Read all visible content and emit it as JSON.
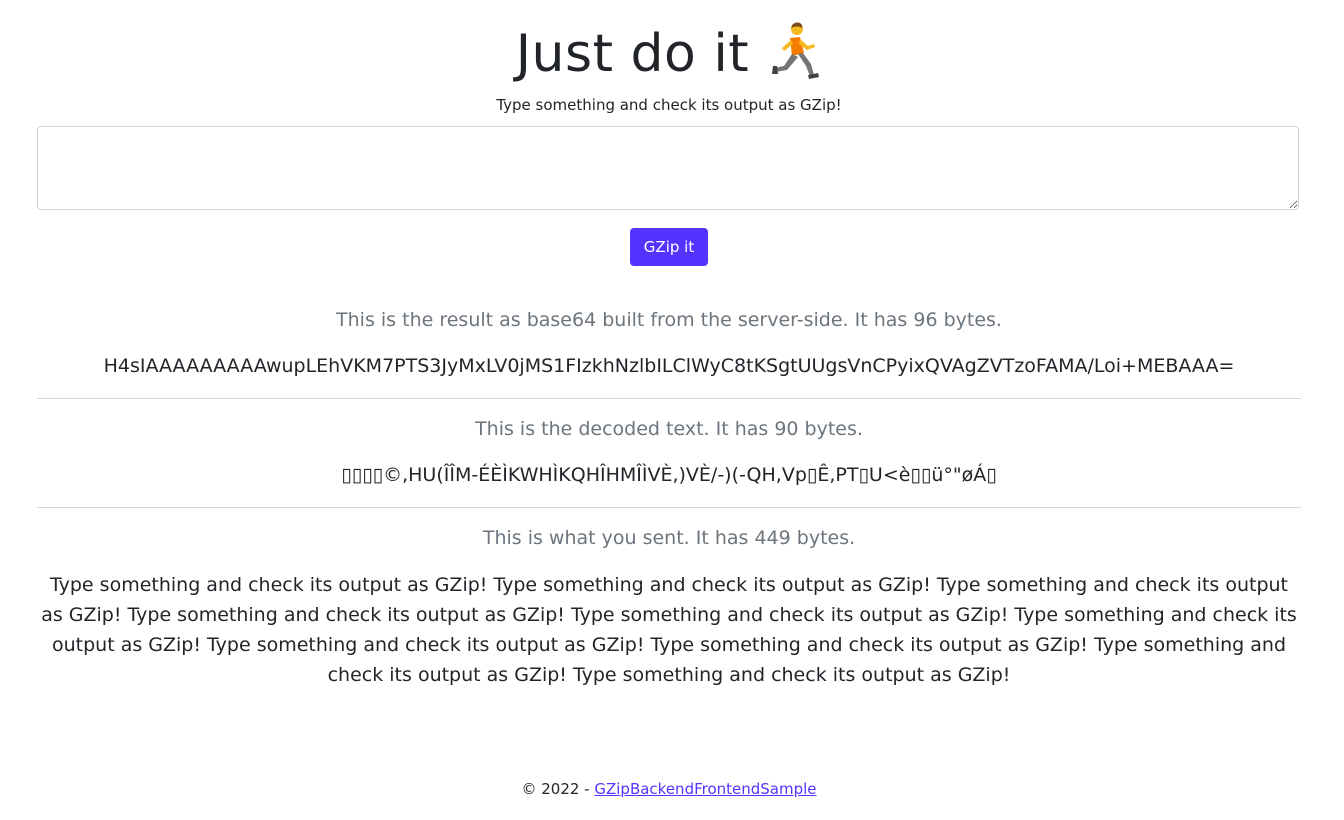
{
  "header": {
    "title": "Just do it",
    "title_emoji_icon": "person-running-icon",
    "subtitle": "Type something and check its output as GZip!"
  },
  "form": {
    "textarea_value": "",
    "button_label": "GZip it",
    "accent_color": "#5533ff"
  },
  "results": {
    "base64_caption": "This is the result as base64 built from the server-side. It has 96 bytes.",
    "base64_value": "H4sIAAAAAAAAAwupLEhVKM7PTS3JyMxLV0jMS1FIzkhNzlbILClWyC8tKSgtUUgsVnCPyixQVAgZVTzoFAMA/Loi+MEBAAA=",
    "decoded_caption": "This is the decoded text. It has 90 bytes.",
    "decoded_value": "▯▯▯▯©,HU(ÎÎM-ÉÈÌKWHÌKQHÎHMÎÌVÈ,)VÈ/-)(-QH,Vp▯Ê,PT▯U<è▯▯ü°\"øÁ▯",
    "sent_caption": "This is what you sent. It has 449 bytes.",
    "sent_value": "Type something and check its output as GZip! Type something and check its output as GZip! Type something and check its output as GZip! Type something and check its output as GZip! Type something and check its output as GZip! Type something and check its output as GZip! Type something and check its output as GZip! Type something and check its output as GZip! Type something and check its output as GZip! Type something and check its output as GZip!"
  },
  "footer": {
    "copyright": "© 2022 - ",
    "link_label": "GZipBackendFrontendSample"
  }
}
